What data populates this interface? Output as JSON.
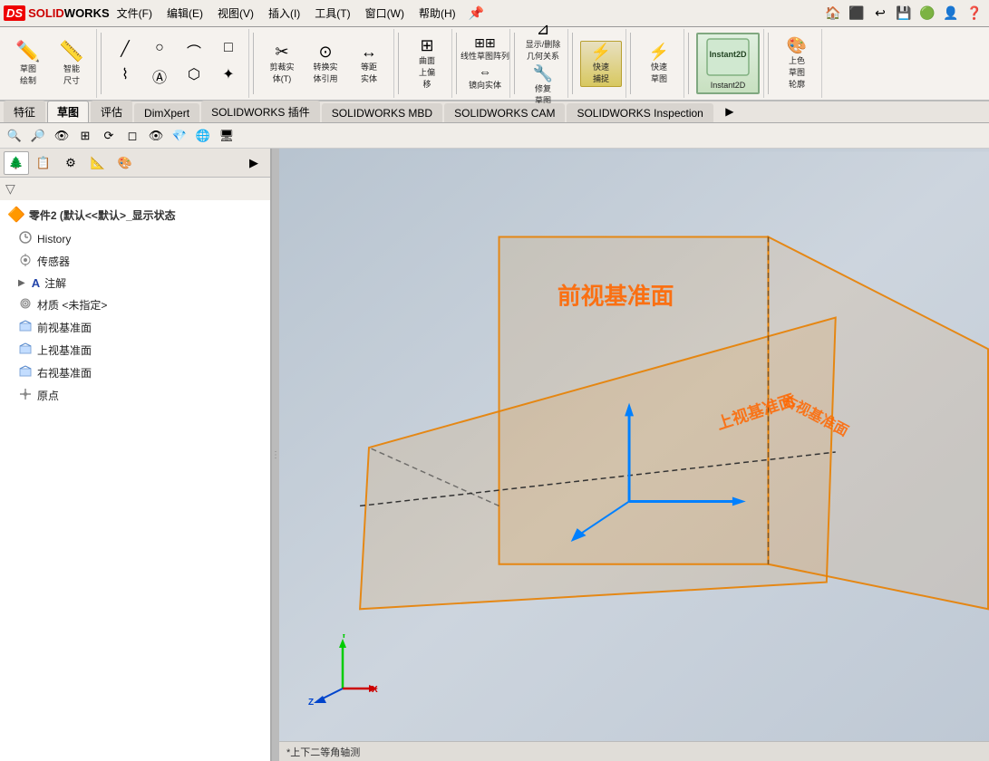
{
  "app": {
    "title": "SOLIDWORKS",
    "logo_ds": "DS",
    "logo_solid": "SOLID",
    "logo_works": "WORKS"
  },
  "menubar": {
    "items": [
      {
        "label": "文件(F)"
      },
      {
        "label": "编辑(E)"
      },
      {
        "label": "视图(V)"
      },
      {
        "label": "插入(I)"
      },
      {
        "label": "工具(T)"
      },
      {
        "label": "窗口(W)"
      },
      {
        "label": "帮助(H)"
      }
    ],
    "pin_label": "📌"
  },
  "ribbon": {
    "tools": [
      {
        "icon": "✏️",
        "label": "草图\n绘制"
      },
      {
        "icon": "📐",
        "label": "智能\n尺寸"
      },
      {
        "icon": "╱",
        "label": "线条"
      },
      {
        "icon": "○",
        "label": "圆"
      },
      {
        "icon": "⌒",
        "label": "弧"
      },
      {
        "icon": "✦",
        "label": "多边形"
      },
      {
        "icon": "Ⓐ",
        "label": "文字"
      },
      {
        "icon": "✂",
        "label": "剪裁实\n体(T)"
      },
      {
        "icon": "⊙",
        "label": "转换实\n体引用"
      },
      {
        "icon": "↔",
        "label": "等距\n实体"
      },
      {
        "icon": "⊞",
        "label": "曲面\n上偏\n移"
      },
      {
        "icon": "≡",
        "label": "线性草图阵列"
      },
      {
        "icon": "↔",
        "label": "镜向实体"
      },
      {
        "icon": "⊿",
        "label": "显示/删除\n几何关系"
      },
      {
        "icon": "🔧",
        "label": "修复\n草图"
      },
      {
        "icon": "⚡",
        "label": "快速\n捕捉"
      },
      {
        "icon": "⚡",
        "label": "快速\n草图"
      },
      {
        "icon": "Instant2D",
        "label": "Instant2D"
      },
      {
        "icon": "🎨",
        "label": "上色\n草图\n轮廓"
      }
    ]
  },
  "tabs": [
    {
      "label": "特征",
      "active": false
    },
    {
      "label": "草图",
      "active": true
    },
    {
      "label": "评估",
      "active": false
    },
    {
      "label": "DimXpert",
      "active": false
    },
    {
      "label": "SOLIDWORKS 插件",
      "active": false
    },
    {
      "label": "SOLIDWORKS MBD",
      "active": false
    },
    {
      "label": "SOLIDWORKS CAM",
      "active": false
    },
    {
      "label": "SOLIDWORKS Inspection",
      "active": false
    }
  ],
  "feature_tree": {
    "part_name": "零件2 (默认<<默认>_显示状态",
    "items": [
      {
        "icon": "🕐",
        "label": "History",
        "indent": 0
      },
      {
        "icon": "📡",
        "label": "传感器",
        "indent": 0
      },
      {
        "icon": "Ⓐ",
        "label": "注解",
        "indent": 0,
        "expandable": true
      },
      {
        "icon": "⚙",
        "label": "材质 <未指定>",
        "indent": 0
      },
      {
        "icon": "▣",
        "label": "前视基准面",
        "indent": 0
      },
      {
        "icon": "▣",
        "label": "上视基准面",
        "indent": 0
      },
      {
        "icon": "▣",
        "label": "右视基准面",
        "indent": 0
      },
      {
        "icon": "✛",
        "label": "原点",
        "indent": 0
      }
    ]
  },
  "scene": {
    "plane_labels": {
      "front": "前视基准面",
      "top": "上视基准面",
      "right": "右视基准面"
    }
  },
  "statusbar": {
    "text": "*上下二等角轴测"
  },
  "secondary_toolbar": {
    "icons": [
      "🔍",
      "🔎",
      "👁",
      "⊞",
      "⟳",
      "🔲",
      "👁",
      "💎",
      "🌐",
      "🖥"
    ]
  }
}
